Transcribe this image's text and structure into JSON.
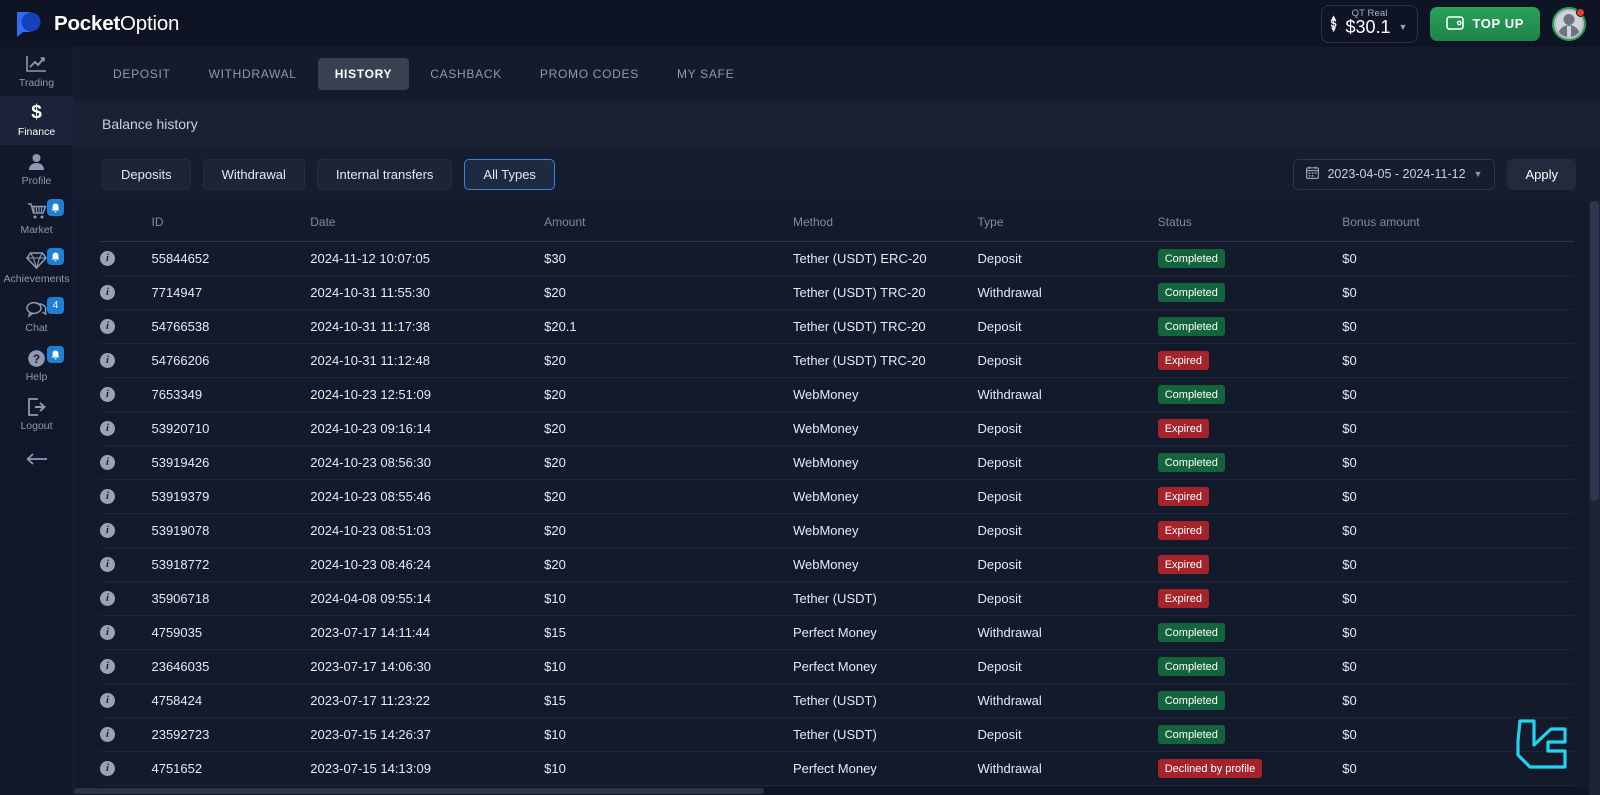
{
  "brand": {
    "bold": "Pocket",
    "light": "Option"
  },
  "account": {
    "type_label": "QT Real",
    "balance": "$30.1",
    "topup_label": "TOP UP"
  },
  "sidebar": {
    "items": [
      {
        "label": "Trading",
        "icon": "chart-line-icon",
        "active": false,
        "badge": ""
      },
      {
        "label": "Finance",
        "icon": "dollar-icon",
        "active": true,
        "badge": ""
      },
      {
        "label": "Profile",
        "icon": "person-icon",
        "active": false,
        "badge": ""
      },
      {
        "label": "Market",
        "icon": "cart-icon",
        "active": false,
        "badge": "bell"
      },
      {
        "label": "Achievements",
        "icon": "diamond-icon",
        "active": false,
        "badge": "bell"
      },
      {
        "label": "Chat",
        "icon": "chat-icon",
        "active": false,
        "badge": "4"
      },
      {
        "label": "Help",
        "icon": "question-icon",
        "active": false,
        "badge": "bell"
      },
      {
        "label": "Logout",
        "icon": "logout-icon",
        "active": false,
        "badge": ""
      }
    ],
    "collapse_icon": "arrow-left-icon"
  },
  "tabs": [
    {
      "label": "DEPOSIT",
      "active": false
    },
    {
      "label": "WITHDRAWAL",
      "active": false
    },
    {
      "label": "HISTORY",
      "active": true
    },
    {
      "label": "CASHBACK",
      "active": false
    },
    {
      "label": "PROMO CODES",
      "active": false
    },
    {
      "label": "MY SAFE",
      "active": false
    }
  ],
  "subheader": {
    "title": "Balance history"
  },
  "filters": {
    "types": [
      {
        "label": "Deposits",
        "selected": false
      },
      {
        "label": "Withdrawal",
        "selected": false
      },
      {
        "label": "Internal transfers",
        "selected": false
      },
      {
        "label": "All Types",
        "selected": true
      }
    ],
    "date_range": "2023-04-05 - 2024-11-12",
    "apply_label": "Apply"
  },
  "table": {
    "columns": [
      "",
      "ID",
      "Date",
      "Amount",
      "Method",
      "Type",
      "Status",
      "Bonus amount"
    ],
    "rows": [
      {
        "id": "55844652",
        "date": "2024-11-12 10:07:05",
        "amount": "$30",
        "method": "Tether (USDT) ERC-20",
        "type": "Deposit",
        "status": "Completed",
        "status_kind": "completed",
        "bonus": "$0"
      },
      {
        "id": "7714947",
        "date": "2024-10-31 11:55:30",
        "amount": "$20",
        "method": "Tether (USDT) TRC-20",
        "type": "Withdrawal",
        "status": "Completed",
        "status_kind": "completed",
        "bonus": "$0"
      },
      {
        "id": "54766538",
        "date": "2024-10-31 11:17:38",
        "amount": "$20.1",
        "method": "Tether (USDT) TRC-20",
        "type": "Deposit",
        "status": "Completed",
        "status_kind": "completed",
        "bonus": "$0"
      },
      {
        "id": "54766206",
        "date": "2024-10-31 11:12:48",
        "amount": "$20",
        "method": "Tether (USDT) TRC-20",
        "type": "Deposit",
        "status": "Expired",
        "status_kind": "expired",
        "bonus": "$0"
      },
      {
        "id": "7653349",
        "date": "2024-10-23 12:51:09",
        "amount": "$20",
        "method": "WebMoney",
        "type": "Withdrawal",
        "status": "Completed",
        "status_kind": "completed",
        "bonus": "$0"
      },
      {
        "id": "53920710",
        "date": "2024-10-23 09:16:14",
        "amount": "$20",
        "method": "WebMoney",
        "type": "Deposit",
        "status": "Expired",
        "status_kind": "expired",
        "bonus": "$0"
      },
      {
        "id": "53919426",
        "date": "2024-10-23 08:56:30",
        "amount": "$20",
        "method": "WebMoney",
        "type": "Deposit",
        "status": "Completed",
        "status_kind": "completed",
        "bonus": "$0"
      },
      {
        "id": "53919379",
        "date": "2024-10-23 08:55:46",
        "amount": "$20",
        "method": "WebMoney",
        "type": "Deposit",
        "status": "Expired",
        "status_kind": "expired",
        "bonus": "$0"
      },
      {
        "id": "53919078",
        "date": "2024-10-23 08:51:03",
        "amount": "$20",
        "method": "WebMoney",
        "type": "Deposit",
        "status": "Expired",
        "status_kind": "expired",
        "bonus": "$0"
      },
      {
        "id": "53918772",
        "date": "2024-10-23 08:46:24",
        "amount": "$20",
        "method": "WebMoney",
        "type": "Deposit",
        "status": "Expired",
        "status_kind": "expired",
        "bonus": "$0"
      },
      {
        "id": "35906718",
        "date": "2024-04-08 09:55:14",
        "amount": "$10",
        "method": "Tether (USDT)",
        "type": "Deposit",
        "status": "Expired",
        "status_kind": "expired",
        "bonus": "$0"
      },
      {
        "id": "4759035",
        "date": "2023-07-17 14:11:44",
        "amount": "$15",
        "method": "Perfect Money",
        "type": "Withdrawal",
        "status": "Completed",
        "status_kind": "completed",
        "bonus": "$0"
      },
      {
        "id": "23646035",
        "date": "2023-07-17 14:06:30",
        "amount": "$10",
        "method": "Perfect Money",
        "type": "Deposit",
        "status": "Completed",
        "status_kind": "completed",
        "bonus": "$0"
      },
      {
        "id": "4758424",
        "date": "2023-07-17 11:23:22",
        "amount": "$15",
        "method": "Tether (USDT)",
        "type": "Withdrawal",
        "status": "Completed",
        "status_kind": "completed",
        "bonus": "$0"
      },
      {
        "id": "23592723",
        "date": "2023-07-15 14:26:37",
        "amount": "$10",
        "method": "Tether (USDT)",
        "type": "Deposit",
        "status": "Completed",
        "status_kind": "completed",
        "bonus": "$0"
      },
      {
        "id": "4751652",
        "date": "2023-07-15 14:13:09",
        "amount": "$10",
        "method": "Perfect Money",
        "type": "Withdrawal",
        "status": "Declined by profile",
        "status_kind": "declined",
        "bonus": "$0"
      }
    ]
  },
  "colors": {
    "accent_blue": "#3b82d9",
    "green": "#27a35a",
    "badge_green": "#13643c",
    "badge_red": "#a5232b",
    "watermark_cyan": "#22d3ee",
    "page_bg": "#131a2b"
  }
}
